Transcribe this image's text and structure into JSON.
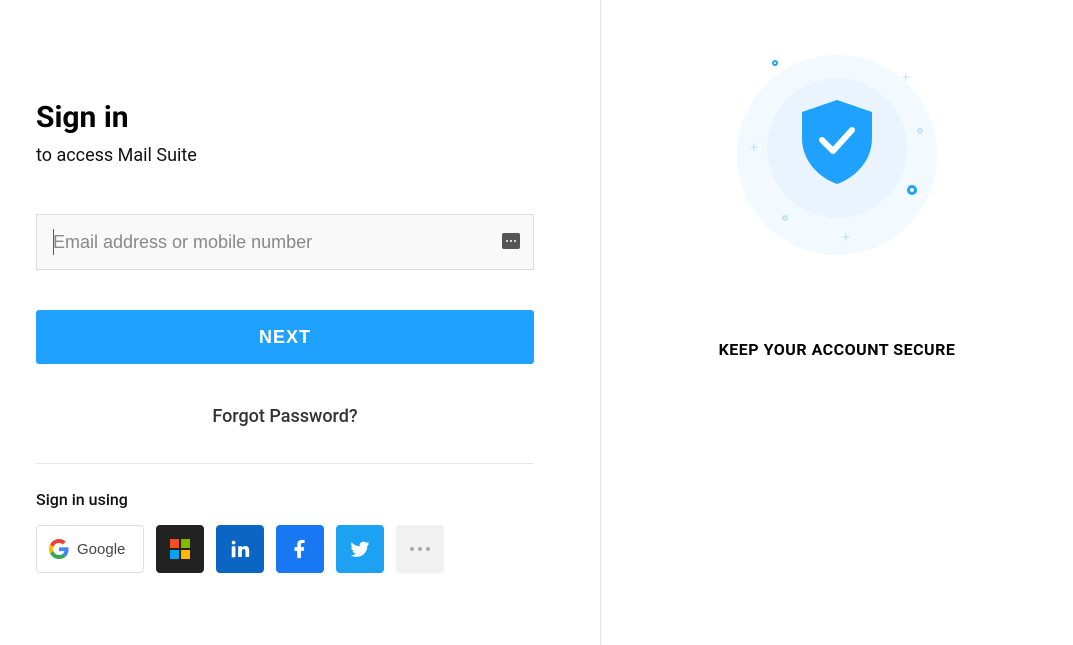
{
  "signin": {
    "title": "Sign in",
    "subtitle": "to access Mail Suite",
    "email_placeholder": "Email address or mobile number",
    "next_label": "NEXT",
    "forgot_label": "Forgot Password?",
    "using_label": "Sign in using",
    "google_label": "Google"
  },
  "promo": {
    "headline": "KEEP YOUR ACCOUNT SECURE"
  }
}
